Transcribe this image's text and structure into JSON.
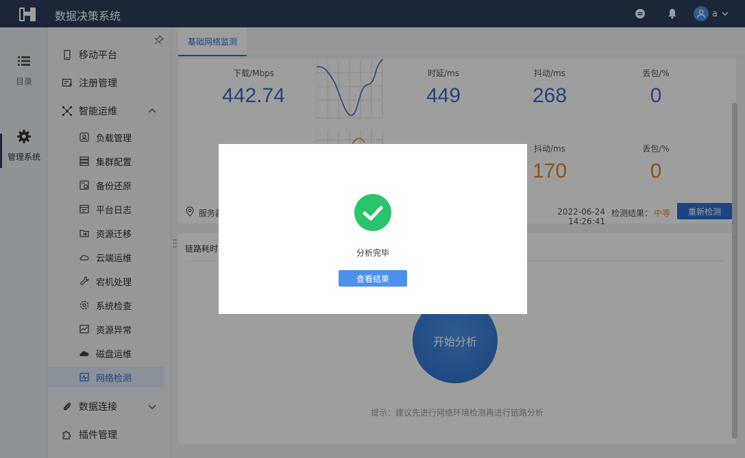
{
  "app": {
    "title": "数据决策系统",
    "user": "a"
  },
  "rail": {
    "items": [
      {
        "label": "目录"
      },
      {
        "label": "管理系统"
      }
    ]
  },
  "menu": {
    "items": [
      {
        "label": "移动平台"
      },
      {
        "label": "注册管理"
      },
      {
        "label": "智能运维"
      },
      {
        "label": "负载管理"
      },
      {
        "label": "集群配置"
      },
      {
        "label": "备份还原"
      },
      {
        "label": "平台日志"
      },
      {
        "label": "资源迁移"
      },
      {
        "label": "云端运维"
      },
      {
        "label": "宕机处理"
      },
      {
        "label": "系统检查"
      },
      {
        "label": "资源异常"
      },
      {
        "label": "磁盘运维"
      },
      {
        "label": "网络检测"
      },
      {
        "label": "数据连接"
      },
      {
        "label": "插件管理"
      }
    ]
  },
  "tabs": [
    {
      "label": "基础网络监测"
    }
  ],
  "metrics": {
    "row1": {
      "download": {
        "label": "下载/Mbps",
        "value": "442.74"
      },
      "latency": {
        "label": "时延/ms",
        "value": "449"
      },
      "jitter": {
        "label": "抖动/ms",
        "value": "268"
      },
      "loss": {
        "label": "丢包/%",
        "value": "0"
      }
    },
    "row2": {
      "jitter": {
        "label": "抖动/ms",
        "value": "170"
      },
      "loss": {
        "label": "丢包/%",
        "value": "0"
      }
    }
  },
  "service": {
    "label": "服务器",
    "timestamp": "2022-06-24 14:26:41",
    "result_label": "检测结果：",
    "result_value": "中等",
    "recheck": "重新检测"
  },
  "link": {
    "title": "链路耗时",
    "start": "开始分析",
    "hint": "提示：建议先进行网络环境检测再进行链路分析"
  },
  "modal": {
    "message": "分析完毕",
    "button": "查看结果"
  },
  "colors": {
    "topbar": "#2c3e5c",
    "accent": "#2c6fd1",
    "success": "#2bc46a",
    "warning": "#e08a2b"
  }
}
